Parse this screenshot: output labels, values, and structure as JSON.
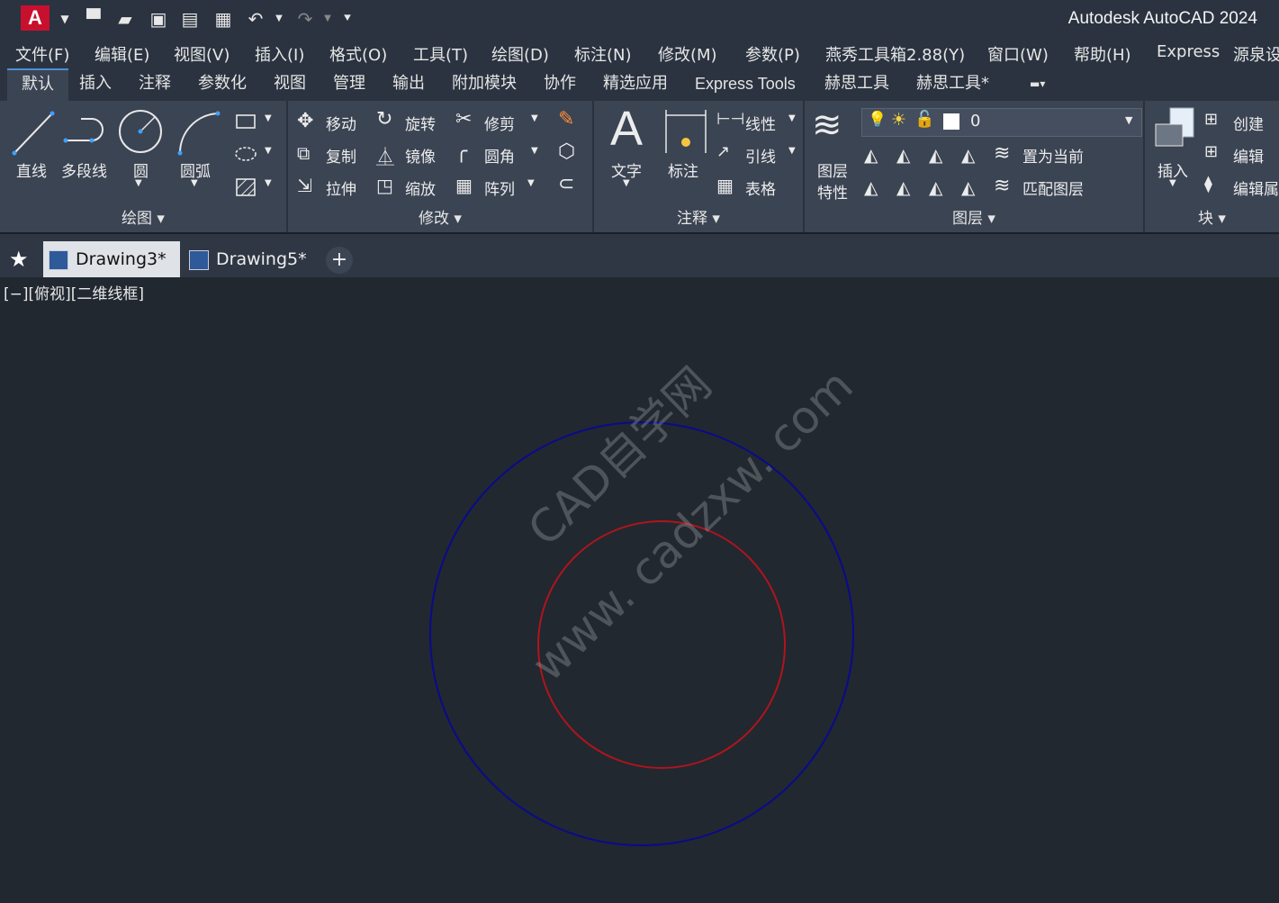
{
  "app": {
    "title": "Autodesk AutoCAD 2024",
    "logo_letter": "A"
  },
  "menu": [
    "文件(F)",
    "编辑(E)",
    "视图(V)",
    "插入(I)",
    "格式(O)",
    "工具(T)",
    "绘图(D)",
    "标注(N)",
    "修改(M)",
    "参数(P)",
    "燕秀工具箱2.88(Y)",
    "窗口(W)",
    "帮助(H)",
    "Express",
    "源泉设"
  ],
  "ribbon_tabs": [
    "默认",
    "插入",
    "注释",
    "参数化",
    "视图",
    "管理",
    "输出",
    "附加模块",
    "协作",
    "精选应用",
    "Express Tools",
    "赫思工具",
    "赫思工具*"
  ],
  "active_tab": "默认",
  "panels": {
    "draw": {
      "title": "绘图",
      "line": "直线",
      "polyline": "多段线",
      "circle": "圆",
      "arc": "圆弧"
    },
    "modify": {
      "title": "修改",
      "move": "移动",
      "rotate": "旋转",
      "trim": "修剪",
      "copy": "复制",
      "mirror": "镜像",
      "fillet": "圆角",
      "stretch": "拉伸",
      "scale": "缩放",
      "array": "阵列"
    },
    "annotation": {
      "title": "注释",
      "text": "文字",
      "dimension": "标注",
      "linear": "线性",
      "leader": "引线",
      "table": "表格"
    },
    "layers": {
      "title": "图层",
      "properties_1": "图层",
      "properties_2": "特性",
      "current_layer": "0",
      "make_current": "置为当前",
      "match_layer": "匹配图层"
    },
    "block": {
      "title": "块",
      "insert": "插入",
      "create": "创建",
      "edit": "编辑",
      "edit_attr": "编辑属"
    }
  },
  "documents": [
    {
      "name": "Drawing3*",
      "active": true
    },
    {
      "name": "Drawing5*",
      "active": false
    }
  ],
  "viewport_label": "[−][俯视][二维线框]",
  "watermark": {
    "line1": "CAD自学网",
    "line2": "www. cadzxw. com"
  },
  "colors": {
    "outer_circle": "#0a0a8c",
    "inner_circle": "#b0141c",
    "app_red": "#c8102e",
    "canvas": "#212830"
  }
}
